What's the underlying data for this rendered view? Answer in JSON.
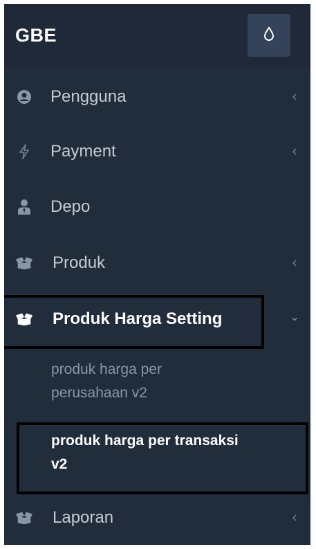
{
  "sidebar": {
    "brand": "GBE",
    "theme_toggle_icon": "droplet-icon",
    "items": [
      {
        "label": "Pengguna",
        "icon": "user-circle-icon",
        "chevron": "chevron-left-icon"
      },
      {
        "label": "Payment",
        "icon": "bolt-icon",
        "chevron": "chevron-left-icon"
      },
      {
        "label": "Depo",
        "icon": "user-tie-icon"
      },
      {
        "label": "Produk",
        "icon": "box-open-icon",
        "chevron": "chevron-left-icon"
      },
      {
        "label": "Produk Harga Setting",
        "icon": "box-open-icon",
        "chevron": "chevron-down-icon",
        "expanded": true
      },
      {
        "label": "Laporan",
        "icon": "box-open-icon",
        "chevron": "chevron-left-icon"
      }
    ],
    "subitems": [
      {
        "label_line1": "produk harga per",
        "label_line2": "perusahaan v2"
      },
      {
        "label_line1": "produk harga per transaksi",
        "label_line2": "v2",
        "current": true
      }
    ]
  },
  "colors": {
    "sidebar_bg": "#222d3c",
    "header_bg": "#1f2937",
    "toggle_bg": "#34435a",
    "text_muted": "#8a96a8",
    "text_active": "#ffffff",
    "highlight_border": "#000000"
  }
}
